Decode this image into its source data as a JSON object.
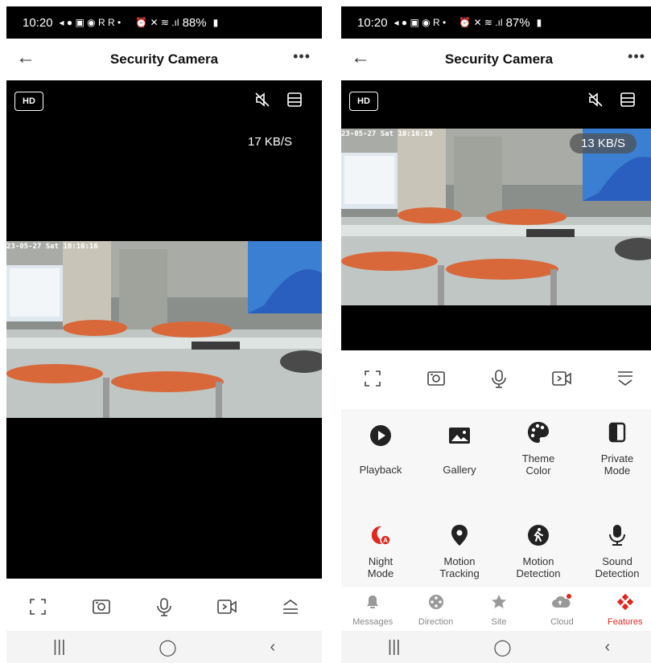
{
  "left": {
    "status": {
      "time": "10:20",
      "battery": "88%"
    },
    "header": {
      "title": "Security Camera"
    },
    "video": {
      "quality": "HD",
      "speed": "17 KB/S",
      "timestamp": "23-05-27 Sat 10:16:16"
    }
  },
  "right": {
    "status": {
      "time": "10:20",
      "battery": "87%"
    },
    "header": {
      "title": "Security Camera"
    },
    "video": {
      "quality": "HD",
      "speed": "13 KB/S",
      "timestamp": "23-05-27 Sat 10:16:19"
    },
    "features": [
      {
        "label": "Playback",
        "icon": "play-circle-icon"
      },
      {
        "label": "Gallery",
        "icon": "image-icon"
      },
      {
        "label": "Theme\nColor",
        "icon": "palette-icon"
      },
      {
        "label": "Private\nMode",
        "icon": "half-shield-icon"
      },
      {
        "label": "Night\nMode",
        "icon": "night-mode-icon"
      },
      {
        "label": "Motion\nTracking",
        "icon": "location-pin-icon"
      },
      {
        "label": "Motion\nDetection",
        "icon": "walking-person-icon"
      },
      {
        "label": "Sound\nDetection",
        "icon": "microphone-icon"
      }
    ],
    "tabs": [
      {
        "label": "Messages",
        "icon": "bell-icon"
      },
      {
        "label": "Direction",
        "icon": "joystick-icon"
      },
      {
        "label": "Site",
        "icon": "star-icon"
      },
      {
        "label": "Cloud",
        "icon": "cloud-icon"
      },
      {
        "label": "Features",
        "icon": "features-icon"
      }
    ]
  },
  "colors": {
    "accent": "#e0271f",
    "video_bg": "#000000",
    "panel_bg": "#f7f7f7"
  }
}
